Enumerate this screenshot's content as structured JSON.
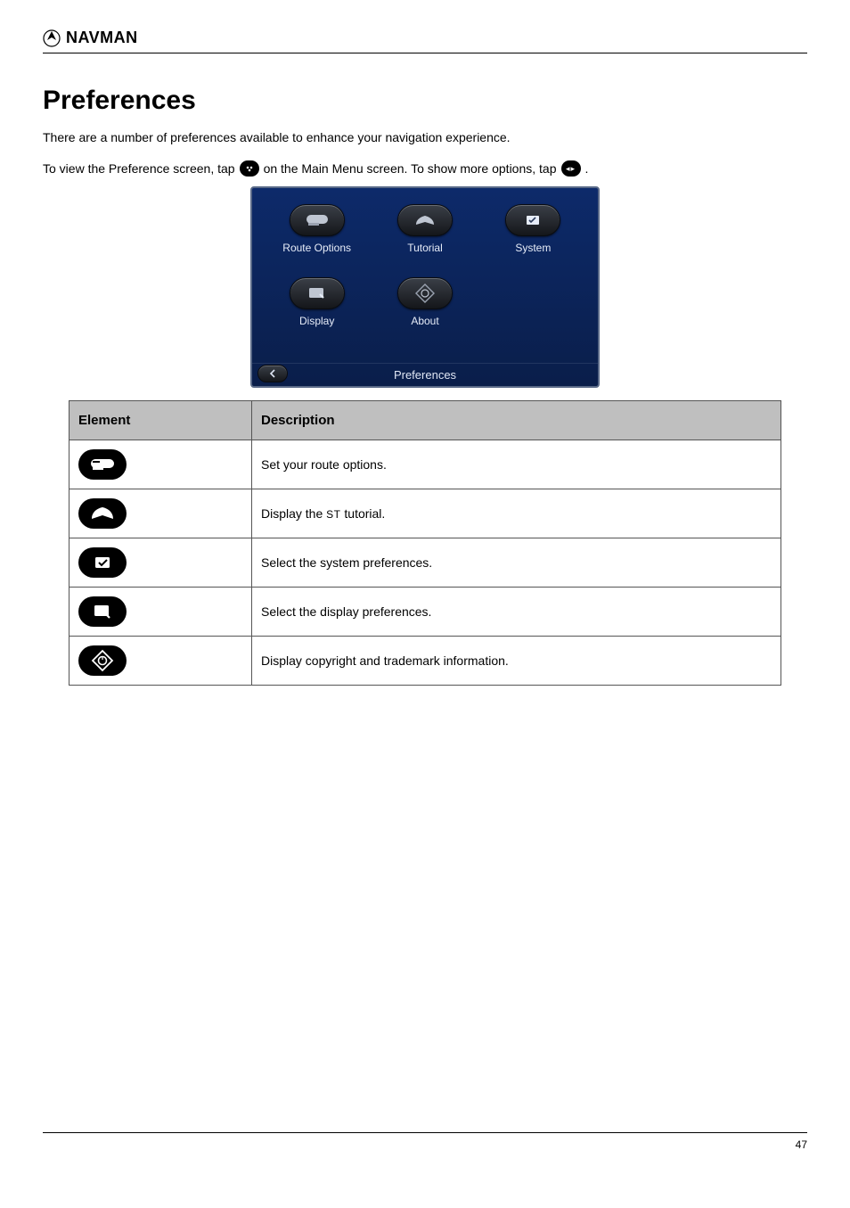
{
  "header": {
    "brand": "NAVMAN"
  },
  "title": "Preferences",
  "intro": "There are a number of preferences available to enhance your navigation experience.",
  "intro_line": {
    "p1": "To view the Preference screen, tap",
    "p2": " on the Main Menu screen. To show more options, tap",
    "p3": "."
  },
  "device": {
    "items": [
      {
        "label": "Route Options"
      },
      {
        "label": "Tutorial"
      },
      {
        "label": "System"
      },
      {
        "label": "Display"
      },
      {
        "label": "About"
      }
    ],
    "footer": "Preferences"
  },
  "table": {
    "headers": [
      "Element",
      "Description"
    ],
    "rows": [
      {
        "desc": "Set your route options."
      },
      {
        "desc_prefix": "Display the ",
        "desc_abbr": "ST",
        "desc_suffix": " tutorial."
      },
      {
        "desc": "Select the system preferences."
      },
      {
        "desc": "Select the display preferences."
      },
      {
        "desc": "Display copyright and trademark information."
      }
    ]
  },
  "footer": {
    "page": "47"
  }
}
